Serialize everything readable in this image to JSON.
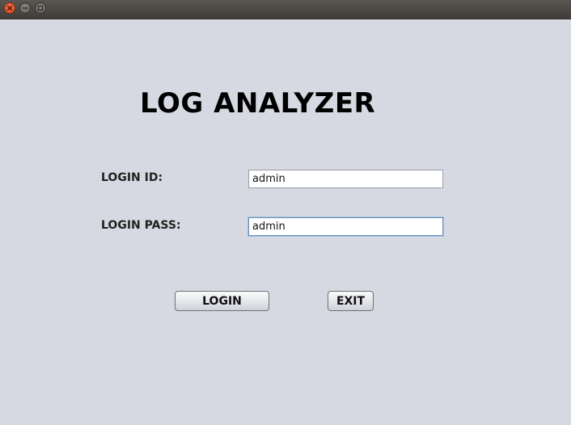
{
  "window": {
    "controls": {
      "close_icon": "close-icon",
      "minimize_icon": "minimize-icon",
      "maximize_icon": "maximize-icon"
    }
  },
  "app": {
    "title": "LOG ANALYZER"
  },
  "form": {
    "login_id_label": "LOGIN ID:",
    "login_id_value": "admin",
    "login_pass_label": "LOGIN PASS:",
    "login_pass_value": "admin",
    "login_button_label": "LOGIN",
    "exit_button_label": "EXIT"
  },
  "colors": {
    "background": "#d6d9e1",
    "titlebar": "#4a4844",
    "close_button": "#e4572a",
    "focus_border": "#6d8fb5"
  }
}
